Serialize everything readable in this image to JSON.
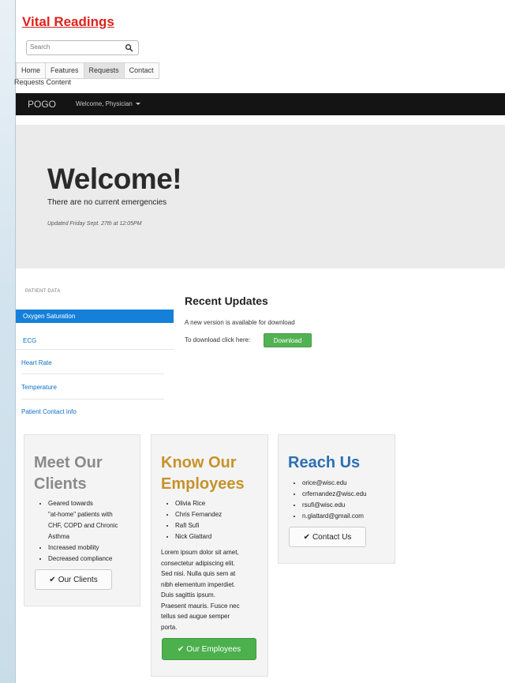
{
  "header": {
    "brand": "Vital Readings",
    "search_placeholder": "Search",
    "tabs": [
      "Home",
      "Features",
      "Requests",
      "Contact"
    ],
    "active_tab": "Requests",
    "tab_content": "Requests Content"
  },
  "navbar": {
    "brand": "POGO",
    "user": "Welcome, Physician"
  },
  "hero": {
    "title": "Welcome!",
    "subtitle": "There are no current emergencies",
    "updated": "Updated Friday Sept. 27th at 12:05PM"
  },
  "sidebar": {
    "header": "PATIENT DATA",
    "items": [
      "Oxygen Saturation",
      "ECG",
      "Heart Rate",
      "Temperature",
      "Patient Contact info"
    ]
  },
  "updates": {
    "title": "Recent Updates",
    "text1": "A new version is available for download",
    "text2": "To download click here:",
    "download_label": "Download"
  },
  "cards": {
    "clients": {
      "title_line1": "Meet Our",
      "title_line2": "Clients",
      "bullets": [
        "Geared towards",
        "\"at-home\" patients with",
        "CHF, COPD and Chronic",
        "Asthma",
        "Increased mobility",
        "Decreased compliance"
      ],
      "button": "Our Clients"
    },
    "employees": {
      "title_line1": "Know Our",
      "title_line2": "Employees",
      "bullets": [
        "Olivia Rice",
        "Chris Fernandez",
        "Rafi Sufi",
        "Nick Glattard"
      ],
      "para": [
        "Lorem ipsum dolor sit amet,",
        "consectetur adipiscing elit.",
        "Sed nisi. Nulla quis sem at",
        "nibh elementum imperdiet.",
        "Duis sagittis ipsum.",
        "Praesent mauris. Fusce nec",
        "tellus sed augue semper",
        "porta."
      ],
      "button": "Our Employees"
    },
    "contact": {
      "title": "Reach Us",
      "emails": [
        "orice@wisc.edu",
        "crfernandez@wisc.edu",
        "rsufi@wisc.edu",
        "n.glattard@gmail.com"
      ],
      "button": "Contact Us"
    }
  },
  "colors": {
    "brand": "#e0211d",
    "navbar": "#141414",
    "active_sidebar": "#1580d9",
    "link": "#0c6fc4",
    "clients_title": "#8a8a8a",
    "employees_title": "#c6922b",
    "contact_title": "#2d6fb3",
    "green_button": "#4cb04c"
  },
  "icons": {
    "search": "search-icon",
    "check": "checkmark-icon",
    "caret": "caret-down-icon"
  }
}
